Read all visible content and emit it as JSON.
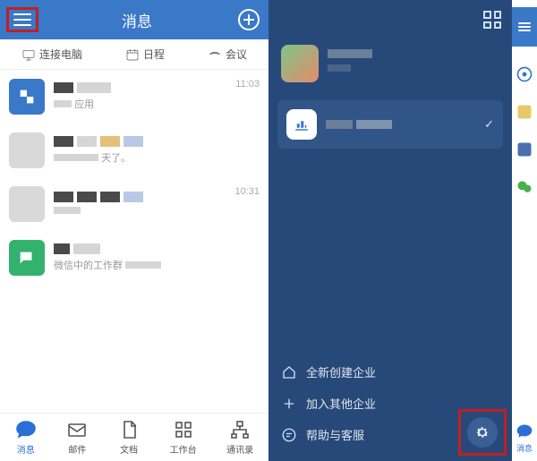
{
  "colors": {
    "brand": "#3a78c8",
    "drawer": "#27497a",
    "highlight": "#c02020"
  },
  "left": {
    "title": "消息",
    "shortcuts": [
      {
        "key": "connect",
        "label": "连接电脑"
      },
      {
        "key": "schedule",
        "label": "日程"
      },
      {
        "key": "meeting",
        "label": "会议"
      }
    ],
    "rows": [
      {
        "time": "11:03",
        "sub": "应用"
      },
      {
        "time": "",
        "sub": "天了。"
      },
      {
        "time": "10:31",
        "sub": ""
      },
      {
        "time": "",
        "sub": "微信中的工作群"
      }
    ],
    "tabs": [
      {
        "key": "msg",
        "label": "消息"
      },
      {
        "key": "mail",
        "label": "邮件"
      },
      {
        "key": "doc",
        "label": "文档"
      },
      {
        "key": "bench",
        "label": "工作台"
      },
      {
        "key": "contacts",
        "label": "通讯录"
      }
    ]
  },
  "drawer": {
    "menu": [
      {
        "key": "create",
        "label": "全新创建企业"
      },
      {
        "key": "join",
        "label": "加入其他企业"
      },
      {
        "key": "help",
        "label": "帮助与客服"
      }
    ]
  },
  "side": {
    "tab_label": "消息"
  }
}
